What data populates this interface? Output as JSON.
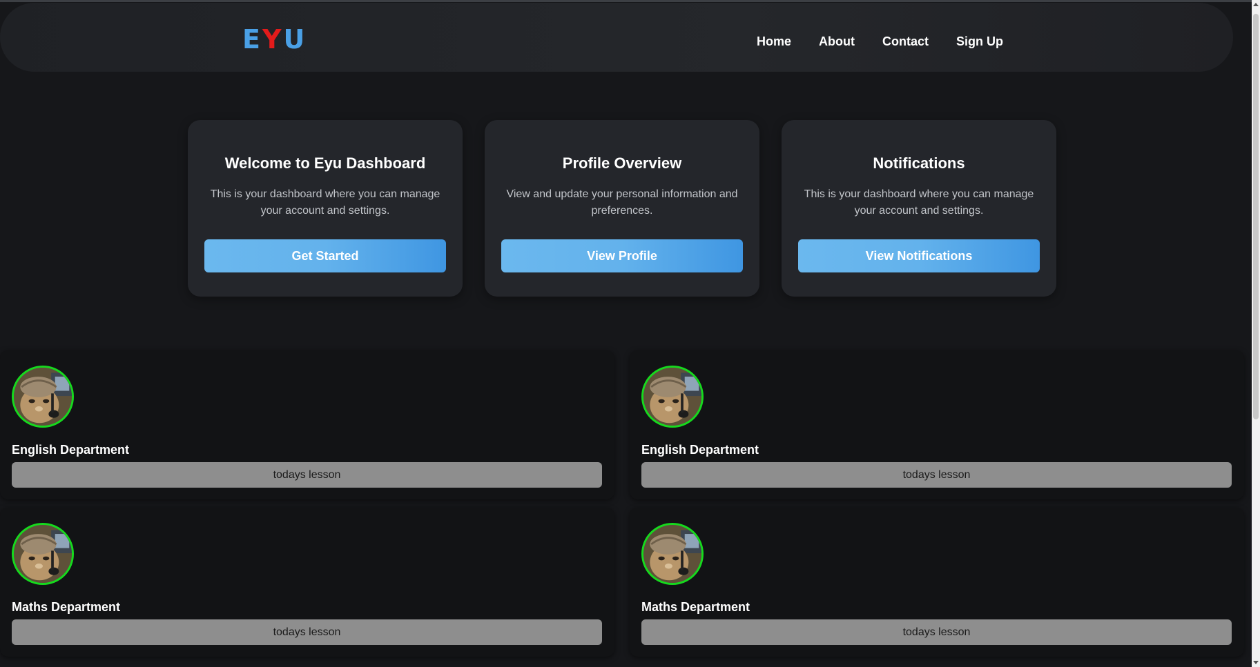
{
  "nav": {
    "logo": [
      "E",
      "Y",
      "U"
    ],
    "links": [
      "Home",
      "About",
      "Contact",
      "Sign Up"
    ]
  },
  "cards": [
    {
      "title": "Welcome to Eyu Dashboard",
      "text": "This is your dashboard where you can manage your account and settings.",
      "button": "Get Started"
    },
    {
      "title": "Profile Overview",
      "text": "View and update your personal information and preferences.",
      "button": "View Profile"
    },
    {
      "title": "Notifications",
      "text": "This is your dashboard where you can manage your account and settings.",
      "button": "View Notifications"
    }
  ],
  "departments": [
    {
      "title": "English Department",
      "button": "todays lesson"
    },
    {
      "title": "English Department",
      "button": "todays lesson"
    },
    {
      "title": "Maths Department",
      "button": "todays lesson"
    },
    {
      "title": "Maths Department",
      "button": "todays lesson"
    }
  ],
  "colors": {
    "background": "#16171a",
    "logo_blue": "#4aa0e6",
    "logo_red": "#e31b1b",
    "avatar_ring": "#16d91e",
    "button_gradient_start": "#6bb8ee",
    "button_gradient_end": "#3f96e2"
  }
}
